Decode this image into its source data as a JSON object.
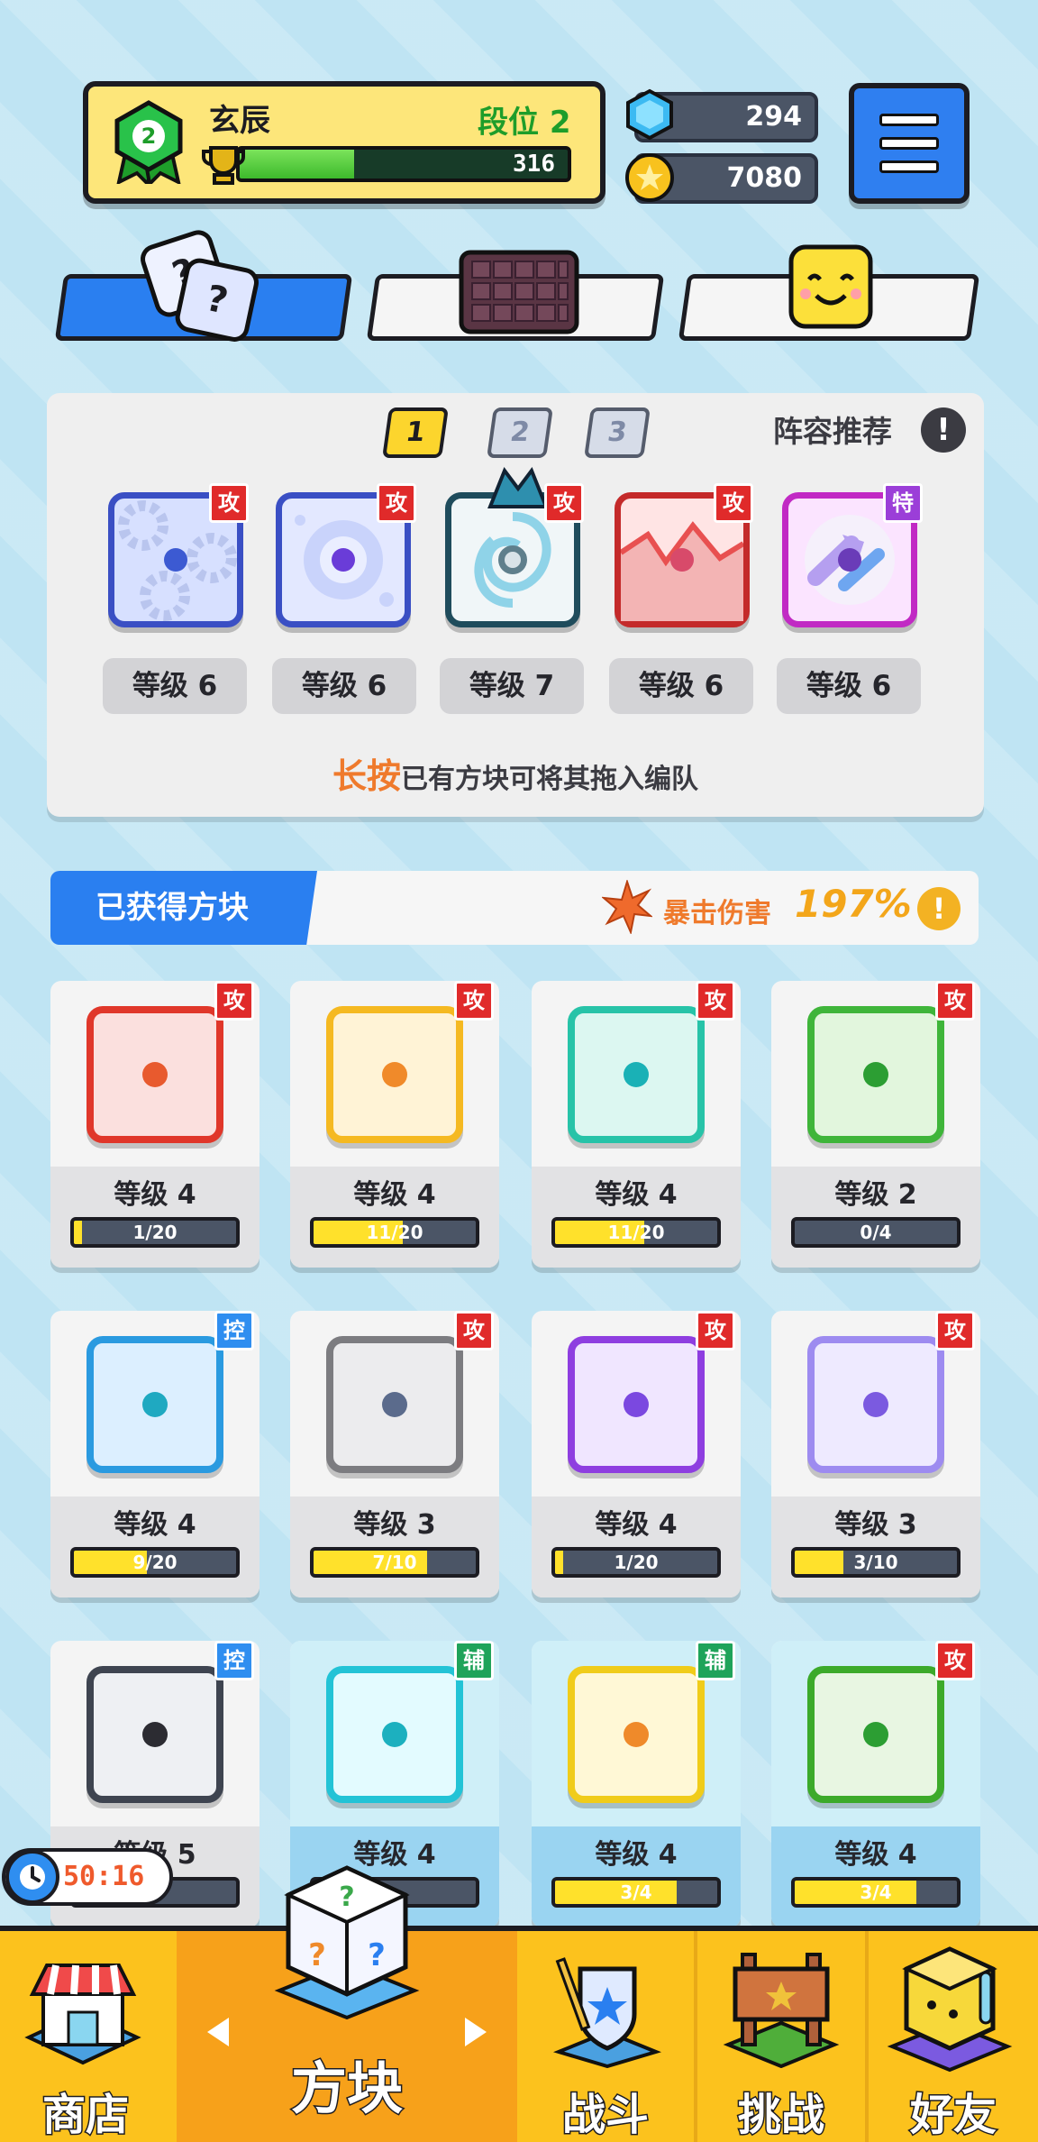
{
  "player": {
    "name": "玄辰",
    "rank_label": "段位  2",
    "rank_number": "2",
    "xp_value": "316",
    "xp_fraction": 0.35
  },
  "currency": {
    "gems": "294",
    "coins": "7080"
  },
  "lineup": {
    "pages": [
      "1",
      "2",
      "3"
    ],
    "active_page": "1",
    "recommend_label": "阵容推荐",
    "info_icon": "!",
    "dice": [
      {
        "type_tag": "攻",
        "level": "等级 6",
        "icon": "gears-die-icon"
      },
      {
        "type_tag": "攻",
        "level": "等级 6",
        "icon": "bubble-die-icon"
      },
      {
        "type_tag": "攻",
        "level": "等级 7",
        "icon": "dragon-vortex-die-icon"
      },
      {
        "type_tag": "攻",
        "level": "等级 6",
        "icon": "crack-die-icon"
      },
      {
        "type_tag": "特",
        "level": "等级 6",
        "icon": "arrow-die-icon"
      }
    ],
    "hint_emphasis": "长按",
    "hint_text": "已有方块可将其拖入编队"
  },
  "obtained": {
    "label": "已获得方块",
    "crit_label": "暴击伤害",
    "crit_value": "197%",
    "info_icon": "!"
  },
  "cards": [
    {
      "tag": "攻",
      "level": "等级 4",
      "progress": "1/20",
      "fraction": 0.05,
      "color": "#e0372a",
      "pip": "#e85a2e",
      "icon": "fire-die-icon"
    },
    {
      "tag": "攻",
      "level": "等级 4",
      "progress": "11/20",
      "fraction": 0.55,
      "color": "#f5b921",
      "pip": "#f08a2a",
      "icon": "electric-die-icon"
    },
    {
      "tag": "攻",
      "level": "等级 4",
      "progress": "11/20",
      "fraction": 0.55,
      "color": "#27c3a8",
      "pip": "#1ab1b6",
      "icon": "wind-die-icon"
    },
    {
      "tag": "攻",
      "level": "等级 2",
      "progress": "0/4",
      "fraction": 0.0,
      "color": "#3fb53a",
      "pip": "#2c9e33",
      "icon": "poison-die-icon"
    },
    {
      "tag": "控",
      "level": "等级 4",
      "progress": "9/20",
      "fraction": 0.45,
      "color": "#2a9ae0",
      "pip": "#1fa9c1",
      "icon": "ice-die-icon"
    },
    {
      "tag": "攻",
      "level": "等级 3",
      "progress": "7/10",
      "fraction": 0.7,
      "color": "#7c7c80",
      "pip": "#5b6b8c",
      "icon": "gear-die-icon"
    },
    {
      "tag": "攻",
      "level": "等级 4",
      "progress": "1/20",
      "fraction": 0.05,
      "color": "#8e3ee0",
      "pip": "#7b48e0",
      "icon": "arrows-die-icon"
    },
    {
      "tag": "攻",
      "level": "等级 3",
      "progress": "3/10",
      "fraction": 0.3,
      "color": "#9d8bf0",
      "pip": "#7b5ae0",
      "icon": "mystery-die-icon"
    },
    {
      "tag": "控",
      "level": "等级 5",
      "progress": "",
      "fraction": 0.4,
      "color": "#3e4450",
      "pip": "#2c2c32",
      "icon": "lock-die-icon"
    },
    {
      "tag": "辅",
      "level": "等级 4",
      "progress": "",
      "fraction": 0.4,
      "color": "#23c3d6",
      "pip": "#1cb0bf",
      "icon": "plus-die-icon"
    },
    {
      "tag": "辅",
      "level": "等级 4",
      "progress": "3/4",
      "fraction": 0.75,
      "color": "#f0cc1a",
      "pip": "#ef8a2a",
      "icon": "arrow-up-die-icon"
    },
    {
      "tag": "攻",
      "level": "等级 4",
      "progress": "3/4",
      "fraction": 0.75,
      "color": "#3caa2a",
      "pip": "#2c9e33",
      "icon": "thorn-die-icon"
    }
  ],
  "timer": "50:16",
  "nav": {
    "shop": "商店",
    "dice": "方块",
    "battle": "战斗",
    "challenge": "挑战",
    "friends": "好友"
  },
  "colors": {
    "accent_blue": "#2a7ff0",
    "nav_yellow": "#fcc21d",
    "tag_attack": "#e02a2a"
  }
}
